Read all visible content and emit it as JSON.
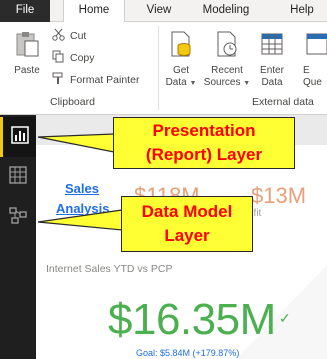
{
  "tabs": {
    "file": "File",
    "home": "Home",
    "view": "View",
    "modeling": "Modeling",
    "help": "Help"
  },
  "clipboard": {
    "paste": "Paste",
    "cut": "Cut",
    "copy": "Copy",
    "format_painter": "Format Painter",
    "group_label": "Clipboard"
  },
  "external_data": {
    "get_data": [
      "Get",
      "Data"
    ],
    "recent_sources": [
      "Recent",
      "Sources"
    ],
    "enter_data": [
      "Enter",
      "Data"
    ],
    "edit_queries": [
      "E",
      "Que"
    ],
    "group_label": "External data"
  },
  "canvas": {
    "sales_link": [
      "Sales",
      "Analysis"
    ],
    "kpi_a": "$118M",
    "kpi_b": "$13M",
    "kpi_b_sub": "ofit",
    "card_title": "Internet Sales YTD vs PCP",
    "big_value": "$16.35M",
    "goal": "Goal: $5.84M (+179.87%)"
  },
  "callouts": {
    "presentation": [
      "Presentation",
      "(Report) Layer"
    ],
    "data_model": [
      "Data Model",
      "Layer"
    ]
  },
  "colors": {
    "accent": "#f2c811",
    "callout_bg": "#ffff33",
    "callout_text": "#ff0000",
    "kpi_green": "#4caf50",
    "link_blue": "#1f6ee8"
  },
  "icons": [
    "cut-icon",
    "copy-icon",
    "format-painter-icon",
    "paste-icon",
    "get-data-icon",
    "recent-sources-icon",
    "enter-data-icon",
    "report-view-icon",
    "data-view-icon",
    "model-view-icon"
  ]
}
